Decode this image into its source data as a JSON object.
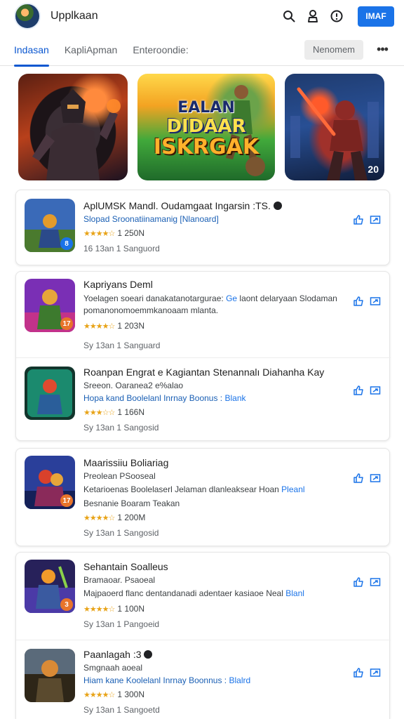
{
  "header": {
    "title": "Upplkaan",
    "cta_label": "IMAF"
  },
  "tabs": [
    {
      "label": "Indasan",
      "active": true
    },
    {
      "label": "KapliApman",
      "active": false
    },
    {
      "label": "Enteroondie:",
      "active": false
    }
  ],
  "filter_chip": "Nenomem",
  "banners": {
    "featured_title": [
      "EALAN",
      "DIDAAR",
      "ISKRGAK"
    ],
    "corner_badge": "20"
  },
  "apps": [
    {
      "title": "AplUMSK Mandl. Oudamgaat Ingarsin :TS.",
      "sub1": "Slopad Sroonatiinamanig [Nlanoard]",
      "sub1_blue": true,
      "rating": "1 250N",
      "meta": "16 13an 1 Sanguord",
      "thumb_badge": "8",
      "colors": [
        "#3a6ab8",
        "#e39b2c",
        "#2b4a8a"
      ]
    },
    {
      "title": "Kapriyans Deml",
      "desc": "Yoelagen soeari danakatanotargurae: ",
      "desc_link": "Ge",
      "desc_rest": " laont delaryaan Slodaman pomanonomoemmkanoaam mlanta.",
      "rating": "1 203N",
      "meta": "Sy 13an 1 Sanguard",
      "thumb_badge": "17",
      "colors": [
        "#7a2fb5",
        "#e7a53a",
        "#c2328a"
      ]
    },
    {
      "title": "Roanpan Engrat e Kagiantan Stenannalı Diahanha Kay",
      "sub1": "Sreeon. Oaranea2 e%alao",
      "tagline": "Hopa kand Boolelanl Inrnay Boonus : ",
      "tagline_link": "Blank",
      "rating": "1 166N",
      "meta": "Sy 13an 1 Sangosid",
      "thumb_badge": "",
      "colors": [
        "#1b8a6e",
        "#e04a2f",
        "#12352c"
      ]
    },
    {
      "title": "Maarissiiu Boliariag",
      "sub1": "Preolean PSooseal",
      "desc": "Ketarioenas Boolelaserl Jelaman dlanleaksear Hoan ",
      "desc_link": "Pleanl",
      "desc_rest": "",
      "sub2": "Besnanie Boaram Teakan",
      "rating": "1 200M",
      "meta": "Sy 13an 1 Sangosid",
      "thumb_badge": "17",
      "colors": [
        "#2a3f9a",
        "#d9412b",
        "#142058"
      ]
    },
    {
      "title": "Sehantain Soalleus",
      "sub1": "Bramaoar. Psaoeal",
      "desc": "Majpaoerd flanc dentandanadi adentaer kasiaoe Neal ",
      "desc_link": "Blanl",
      "desc_rest": "",
      "rating": "1 100N",
      "meta": "Sy 13an 1 Pangoeid",
      "thumb_badge": "3",
      "colors": [
        "#4b3aa7",
        "#f09a2a",
        "#27215a"
      ]
    },
    {
      "title": "Paanlagah :3",
      "sub1": "Smgnaah aoeal",
      "tagline": "Hiam kane Koolelanl Inrnay Boonnus : ",
      "tagline_link": "Blalrd",
      "rating": "1 300N",
      "meta": "Sy 13an 1 Sangoetd",
      "thumb_badge": "",
      "colors": [
        "#5a4a2e",
        "#d98a36",
        "#2e2618"
      ]
    }
  ]
}
